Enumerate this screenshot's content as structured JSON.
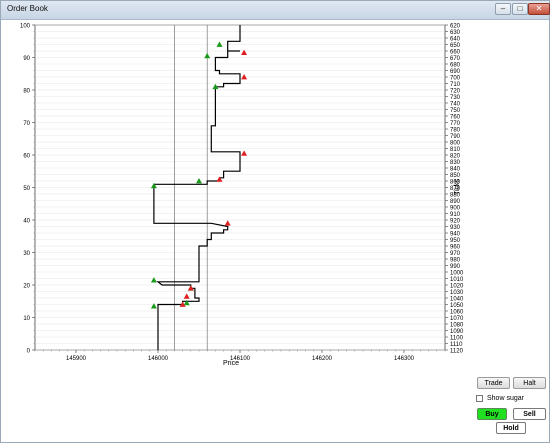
{
  "window": {
    "title": "Order Book"
  },
  "toolbar": {
    "trade_label": "Trade",
    "halt_label": "Halt",
    "show_sugar_label": "Show sugar",
    "show_sugar_checked": false,
    "buy_label": "Buy",
    "sell_label": "Sell",
    "hold_label": "Hold"
  },
  "colors": {
    "buy_accent": "#20e020",
    "up_marker": "#1a9a1a",
    "down_marker": "#e02020"
  },
  "chart_data": {
    "type": "line",
    "xlabel": "Price",
    "ylabel_right": "Ticks",
    "xlim": [
      145850,
      146350
    ],
    "x_ticks": [
      145900,
      146000,
      146100,
      146200,
      146300
    ],
    "ylim_left": [
      0,
      100
    ],
    "y_ticks_left": [
      0,
      10,
      20,
      30,
      40,
      50,
      60,
      70,
      80,
      90,
      100
    ],
    "y_ticks_right": [
      "620",
      "630",
      "640",
      "650",
      "660",
      "670",
      "680",
      "690",
      "700",
      "710",
      "720",
      "730",
      "740",
      "750",
      "760",
      "770",
      "780",
      "790",
      "800",
      "810",
      "820",
      "830",
      "840",
      "850",
      "860",
      "870",
      "880",
      "890",
      "900",
      "910",
      "920",
      "930",
      "940",
      "950",
      "960",
      "970",
      "980",
      "990",
      "1000",
      "1010",
      "1020",
      "1030",
      "1040",
      "1050",
      "1060",
      "1070",
      "1080",
      "1090",
      "1100",
      "1110",
      "1120"
    ],
    "grid": true,
    "vertical_lines": [
      146020,
      146060
    ],
    "price_path": [
      [
        146000,
        0
      ],
      [
        146000,
        14
      ],
      [
        146030,
        14
      ],
      [
        146030,
        15
      ],
      [
        146050,
        15
      ],
      [
        146050,
        16
      ],
      [
        146045,
        16
      ],
      [
        146045,
        19
      ],
      [
        146040,
        19
      ],
      [
        146040,
        20
      ],
      [
        146005,
        20
      ],
      [
        146000,
        21
      ],
      [
        146050,
        21
      ],
      [
        146050,
        32
      ],
      [
        146060,
        32
      ],
      [
        146060,
        34
      ],
      [
        146065,
        34
      ],
      [
        146065,
        36
      ],
      [
        146080,
        36
      ],
      [
        146080,
        37
      ],
      [
        146085,
        37
      ],
      [
        146085,
        38
      ],
      [
        146065,
        39
      ],
      [
        145995,
        39
      ],
      [
        145995,
        51
      ],
      [
        146060,
        51
      ],
      [
        146060,
        52
      ],
      [
        146075,
        52
      ],
      [
        146075,
        53
      ],
      [
        146080,
        53
      ],
      [
        146080,
        55
      ],
      [
        146100,
        55
      ],
      [
        146100,
        61
      ],
      [
        146065,
        61
      ],
      [
        146065,
        69
      ],
      [
        146070,
        69
      ],
      [
        146070,
        81
      ],
      [
        146080,
        81
      ],
      [
        146080,
        82
      ],
      [
        146100,
        82
      ],
      [
        146100,
        85
      ],
      [
        146075,
        85
      ],
      [
        146075,
        86
      ],
      [
        146070,
        86
      ],
      [
        146070,
        90
      ],
      [
        146085,
        90
      ],
      [
        146085,
        92
      ],
      [
        146100,
        92
      ],
      [
        146085,
        92
      ],
      [
        146085,
        95
      ],
      [
        146100,
        95
      ],
      [
        146100,
        100
      ]
    ],
    "up_markers": [
      [
        146035,
        14.5
      ],
      [
        146040,
        19
      ],
      [
        145995,
        13.5
      ],
      [
        145995,
        21.5
      ],
      [
        146050,
        52
      ],
      [
        145995,
        50.5
      ],
      [
        146070,
        81
      ],
      [
        146060,
        90.5
      ],
      [
        146075,
        94
      ]
    ],
    "down_markers": [
      [
        146030,
        14
      ],
      [
        146035,
        16.5
      ],
      [
        146040,
        19
      ],
      [
        146075,
        52.5
      ],
      [
        146085,
        39
      ],
      [
        146105,
        60.5
      ],
      [
        146105,
        84
      ],
      [
        146105,
        91.5
      ]
    ]
  }
}
